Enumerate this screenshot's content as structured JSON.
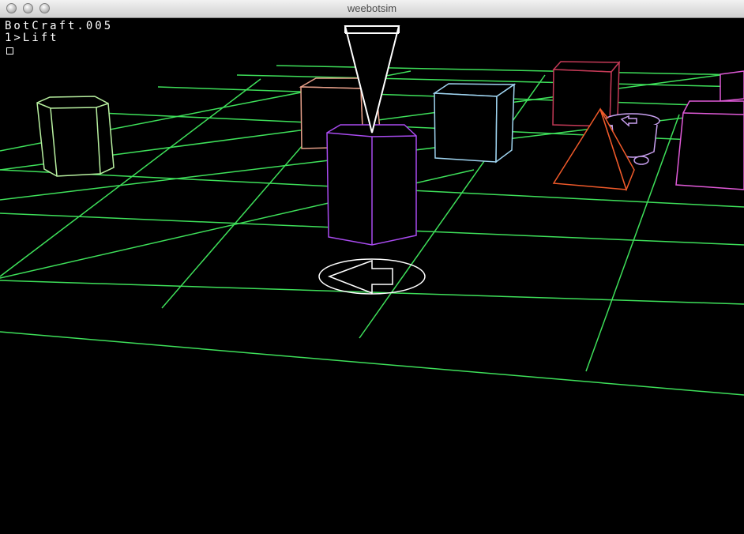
{
  "window": {
    "title": "weebotsim"
  },
  "hud": {
    "line1": "BotCraft.005",
    "line2": "1>Lift"
  },
  "colors": {
    "grid": "#3ee05a",
    "hexagon_player": "#a94bf0",
    "hexagon_left": "#b8f0a0",
    "cube_salmon": "#e7a08a",
    "cube_blue": "#9fd4f0",
    "cube_red": "#c43a57",
    "cube_magenta": "#e05ad8",
    "pyramid": "#f05a2a",
    "cursor": "#ffffff",
    "robot": "#c9a0f0"
  },
  "icons": [
    "close-button",
    "minimize-button",
    "zoom-button",
    "direction-arrow-icon",
    "selection-cone-icon"
  ]
}
